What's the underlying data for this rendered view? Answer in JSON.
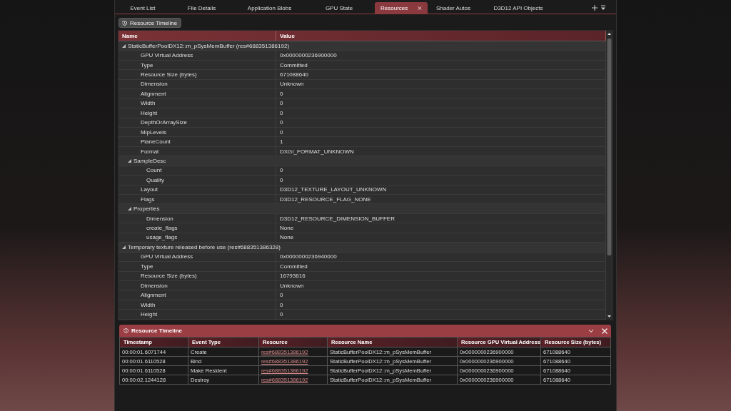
{
  "tabs": [
    {
      "label": "Event List",
      "selected": false,
      "closable": false
    },
    {
      "label": "File Details",
      "selected": false,
      "closable": false
    },
    {
      "label": "Application Blobs",
      "selected": false,
      "closable": false
    },
    {
      "label": "GPU State",
      "selected": false,
      "closable": false
    },
    {
      "label": "Resources",
      "selected": true,
      "closable": true
    },
    {
      "label": "Shader Autos",
      "selected": false,
      "closable": false
    },
    {
      "label": "D3D12 API Objects",
      "selected": false,
      "closable": false
    }
  ],
  "toolbar": {
    "button": "Resource Timeline"
  },
  "tree": {
    "columns": [
      "Name",
      "Value"
    ],
    "items": [
      {
        "name": "StaticBufferPoolDX12::m_pSysMemBuffer (res#688351386192)",
        "expanded": true,
        "children": [
          {
            "name": "GPU Virtual Address",
            "value": "0x0000000236900000"
          },
          {
            "name": "Type",
            "value": "Committed"
          },
          {
            "name": "Resource Size (bytes)",
            "value": "671088640"
          },
          {
            "name": "Dimension",
            "value": "Unknown"
          },
          {
            "name": "Alignment",
            "value": "0"
          },
          {
            "name": "Width",
            "value": "0"
          },
          {
            "name": "Height",
            "value": "0"
          },
          {
            "name": "DepthOrArraySize",
            "value": "0"
          },
          {
            "name": "MipLevels",
            "value": "0"
          },
          {
            "name": "PlaneCount",
            "value": "1"
          },
          {
            "name": "Format",
            "value": "DXGI_FORMAT_UNKNOWN"
          },
          {
            "name": "SampleDesc",
            "expanded": true,
            "children": [
              {
                "name": "Count",
                "value": "0"
              },
              {
                "name": "Quality",
                "value": "0"
              }
            ]
          },
          {
            "name": "Layout",
            "value": "D3D12_TEXTURE_LAYOUT_UNKNOWN"
          },
          {
            "name": "Flags",
            "value": "D3D12_RESOURCE_FLAG_NONE"
          },
          {
            "name": "Properties",
            "expanded": true,
            "children": [
              {
                "name": "Dimension",
                "value": "D3D12_RESOURCE_DIMENSION_BUFFER"
              },
              {
                "name": "create_flags",
                "value": "None"
              },
              {
                "name": "usage_flags",
                "value": "None"
              }
            ]
          }
        ]
      },
      {
        "name": "Temporary texture released before use (res#688351386328)",
        "expanded": true,
        "children": [
          {
            "name": "GPU Virtual Address",
            "value": "0x0000000236940000"
          },
          {
            "name": "Type",
            "value": "Committed"
          },
          {
            "name": "Resource Size (bytes)",
            "value": "16793616"
          },
          {
            "name": "Dimension",
            "value": "Unknown"
          },
          {
            "name": "Alignment",
            "value": "0"
          },
          {
            "name": "Width",
            "value": "0"
          },
          {
            "name": "Height",
            "value": "0"
          }
        ]
      }
    ]
  },
  "timeline": {
    "title": "Resource Timeline",
    "columns": [
      "Timestamp",
      "Event Type",
      "Resource",
      "Resource Name",
      "Resource GPU Virtual Address",
      "Resource Size (bytes)"
    ],
    "rows": [
      [
        "00:00:01.6071744",
        "Create",
        "res#688351386192",
        "StaticBufferPoolDX12::m_pSysMemBuffer",
        "0x0000000236900000",
        "671088640"
      ],
      [
        "00:00:01.6110528",
        "Bind",
        "res#688351386192",
        "StaticBufferPoolDX12::m_pSysMemBuffer",
        "0x0000000236900000",
        "671088640"
      ],
      [
        "00:00:01.6110528",
        "Make Resident",
        "res#688351386192",
        "StaticBufferPoolDX12::m_pSysMemBuffer",
        "0x0000000236900000",
        "671088640"
      ],
      [
        "00:00:02.1244128",
        "Destroy",
        "res#688351386192",
        "StaticBufferPoolDX12::m_pSysMemBuffer",
        "0x0000000236900000",
        "671088640"
      ]
    ]
  }
}
